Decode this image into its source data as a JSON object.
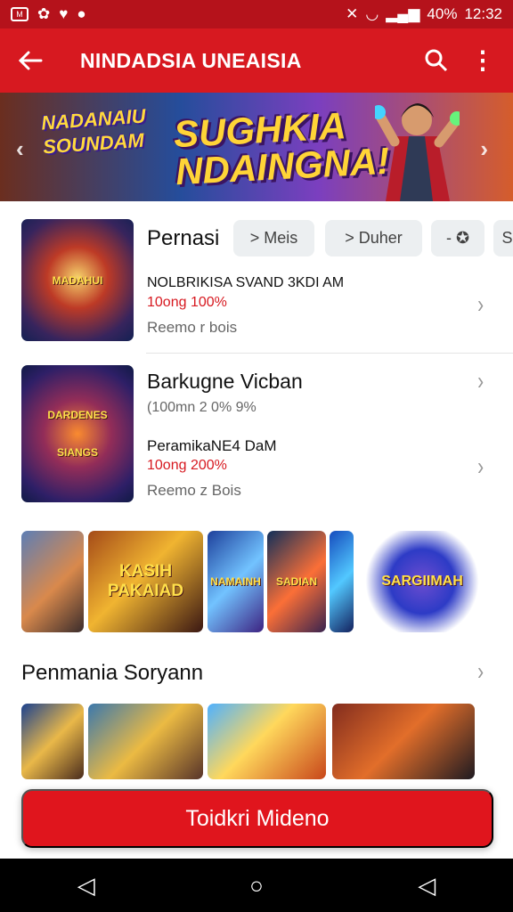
{
  "status_bar": {
    "icon_a": "M",
    "icon_b": "✿",
    "battery": "40%",
    "time": "12:32"
  },
  "header": {
    "title": "NINDADSIA UNEAISIA"
  },
  "banner": {
    "left_logo": "NADANAIU SOUNDAM",
    "main_text_1": "SUGHKIA",
    "main_text_2": "NDAINGNA!"
  },
  "featured": {
    "title": "Pernasi",
    "chips": [
      "> Meis",
      "> Duher",
      "- ✪",
      "Sc"
    ],
    "line_1": "Nolbrikisa svand 3kdi am",
    "rating": "10ong 100%",
    "reviews": "Reemo r bois"
  },
  "second": {
    "title": "Barkugne Vicban",
    "meta": "(100mn 2 0% 9%",
    "line_1": "PeramikaNE4 DaM",
    "rating": "10ong 200%",
    "reviews": "Reemo z Bois"
  },
  "gallery_labels": [
    "",
    "KASIH PAKAIAD",
    "NAMAINH",
    "SADIAN",
    "",
    "SARGIIMAH"
  ],
  "section": {
    "title": "Penmania Soryann"
  },
  "bottom_button": {
    "label": "Toidkri Mideno"
  },
  "colors": {
    "brand": "#d71920",
    "dark_red": "#b5121b"
  }
}
